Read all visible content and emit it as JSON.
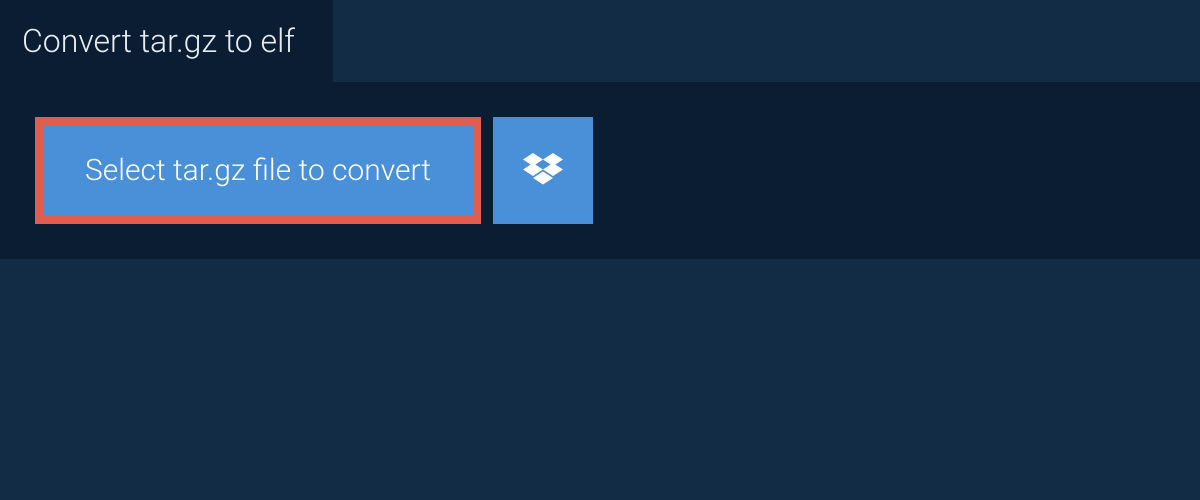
{
  "tab": {
    "title": "Convert tar.gz to elf"
  },
  "actions": {
    "select_label": "Select tar.gz file to convert"
  },
  "colors": {
    "background": "#132c46",
    "panel": "#0a1d33",
    "button": "#4a90d9",
    "button_border": "#e35d4f",
    "text_light": "#e8ecf0",
    "text_white": "#ffffff"
  }
}
